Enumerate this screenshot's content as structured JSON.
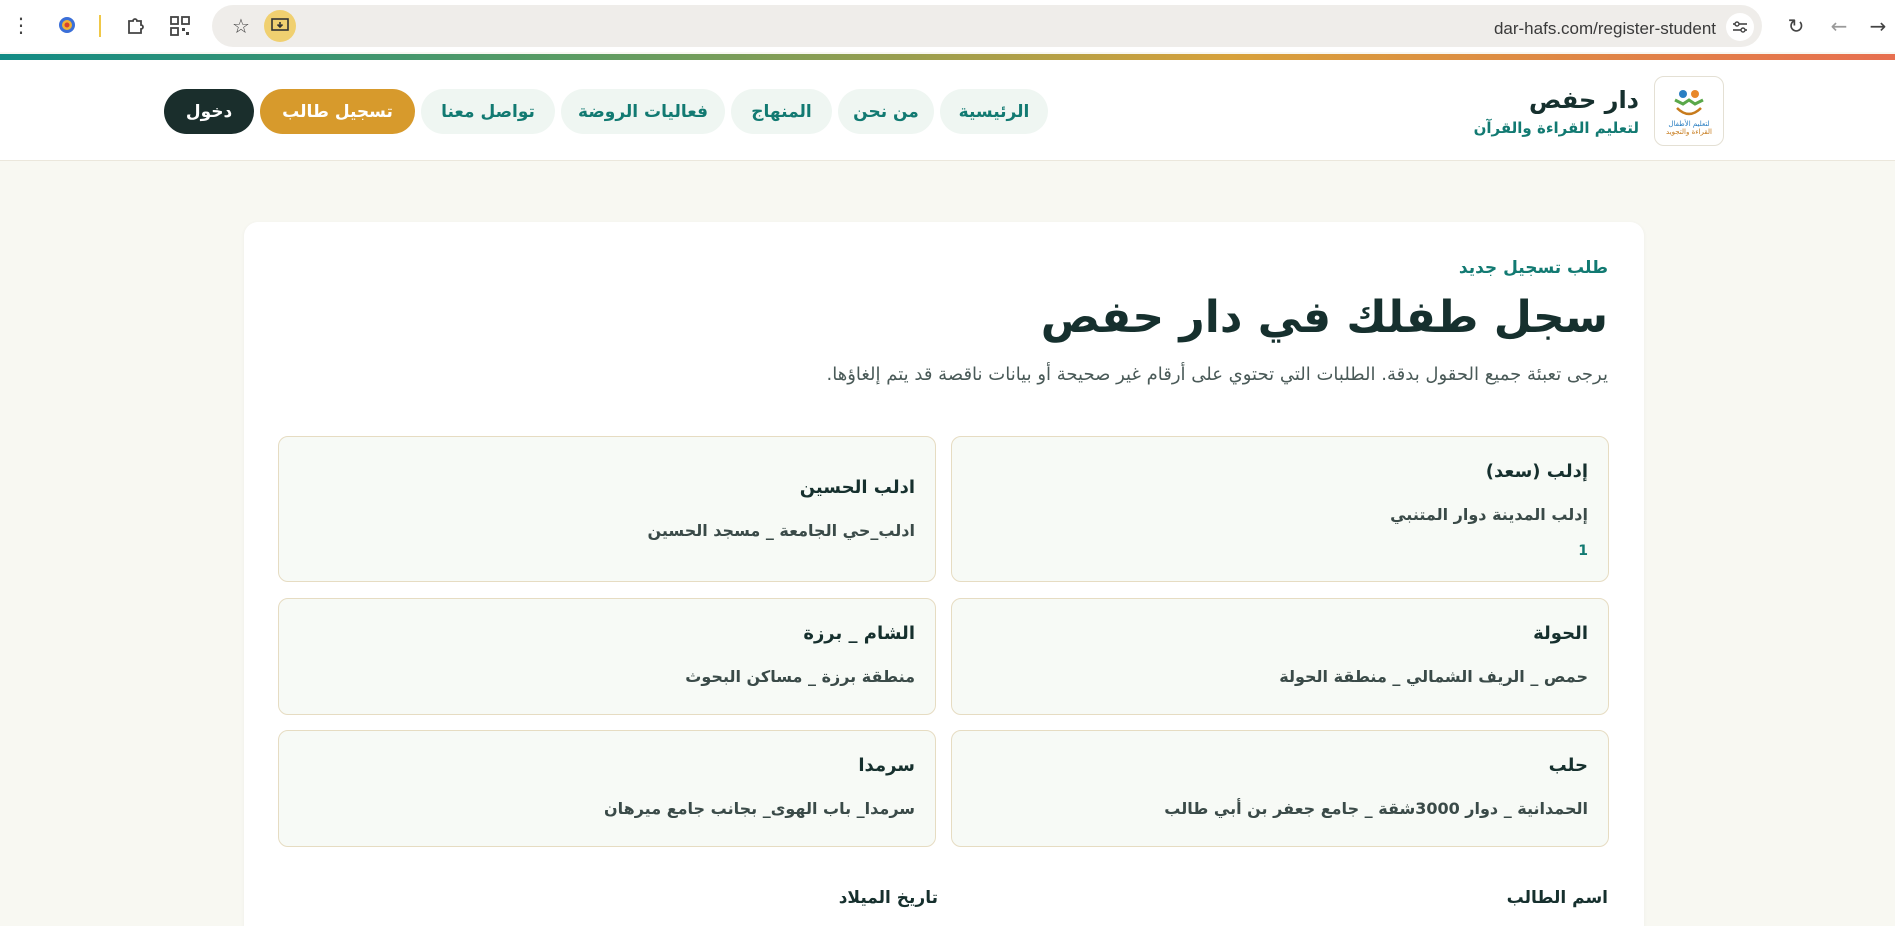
{
  "browser": {
    "url": "dar-hafs.com/register-student"
  },
  "brand": {
    "name": "دار حفص",
    "tagline": "لتعليم القراءة والقرآن",
    "logo_line1": "لتعليم الأطفال",
    "logo_line2": "القراءة والتجويد"
  },
  "nav": {
    "items": [
      {
        "label": "الرئيسية"
      },
      {
        "label": "من نحن"
      },
      {
        "label": "المنهاج"
      },
      {
        "label": "فعاليات الروضة"
      },
      {
        "label": "تواصل معنا"
      }
    ],
    "register_label": "تسجيل طالب",
    "login_label": "دخول"
  },
  "form": {
    "eyebrow": "طلب تسجيل جديد",
    "title": "سجل طفلك في دار حفص",
    "description": "يرجى تعبئة جميع الحقول بدقة. الطلبات التي تحتوي على أرقام غير صحيحة أو بيانات ناقصة قد يتم إلغاؤها.",
    "branches": [
      {
        "name": "إدلب (سعد)",
        "address": "إدلب المدينة دوار المتنبي",
        "number": "1"
      },
      {
        "name": "ادلب الحسين",
        "address": "ادلب_حي الجامعة _ مسجد الحسين"
      },
      {
        "name": "الحولة",
        "address": "حمص _ الريف الشمالي _ منطقة الحولة"
      },
      {
        "name": "الشام _ برزة",
        "address": "منطقة برزة _ مساكن البحوث"
      },
      {
        "name": "حلب",
        "address": "الحمدانية _ دوار 3000شقة _ جامع جعفر بن أبي طالب"
      },
      {
        "name": "سرمدا",
        "address": "سرمدا_ باب الهوى_ بجانب جامع ميرهان"
      }
    ],
    "student_name_label": "اسم الطالب",
    "birth_date_label": "تاريخ الميلاد"
  },
  "colors": {
    "primary": "#127a72",
    "accent": "#d79a2c",
    "dark": "#1a2e2c"
  }
}
